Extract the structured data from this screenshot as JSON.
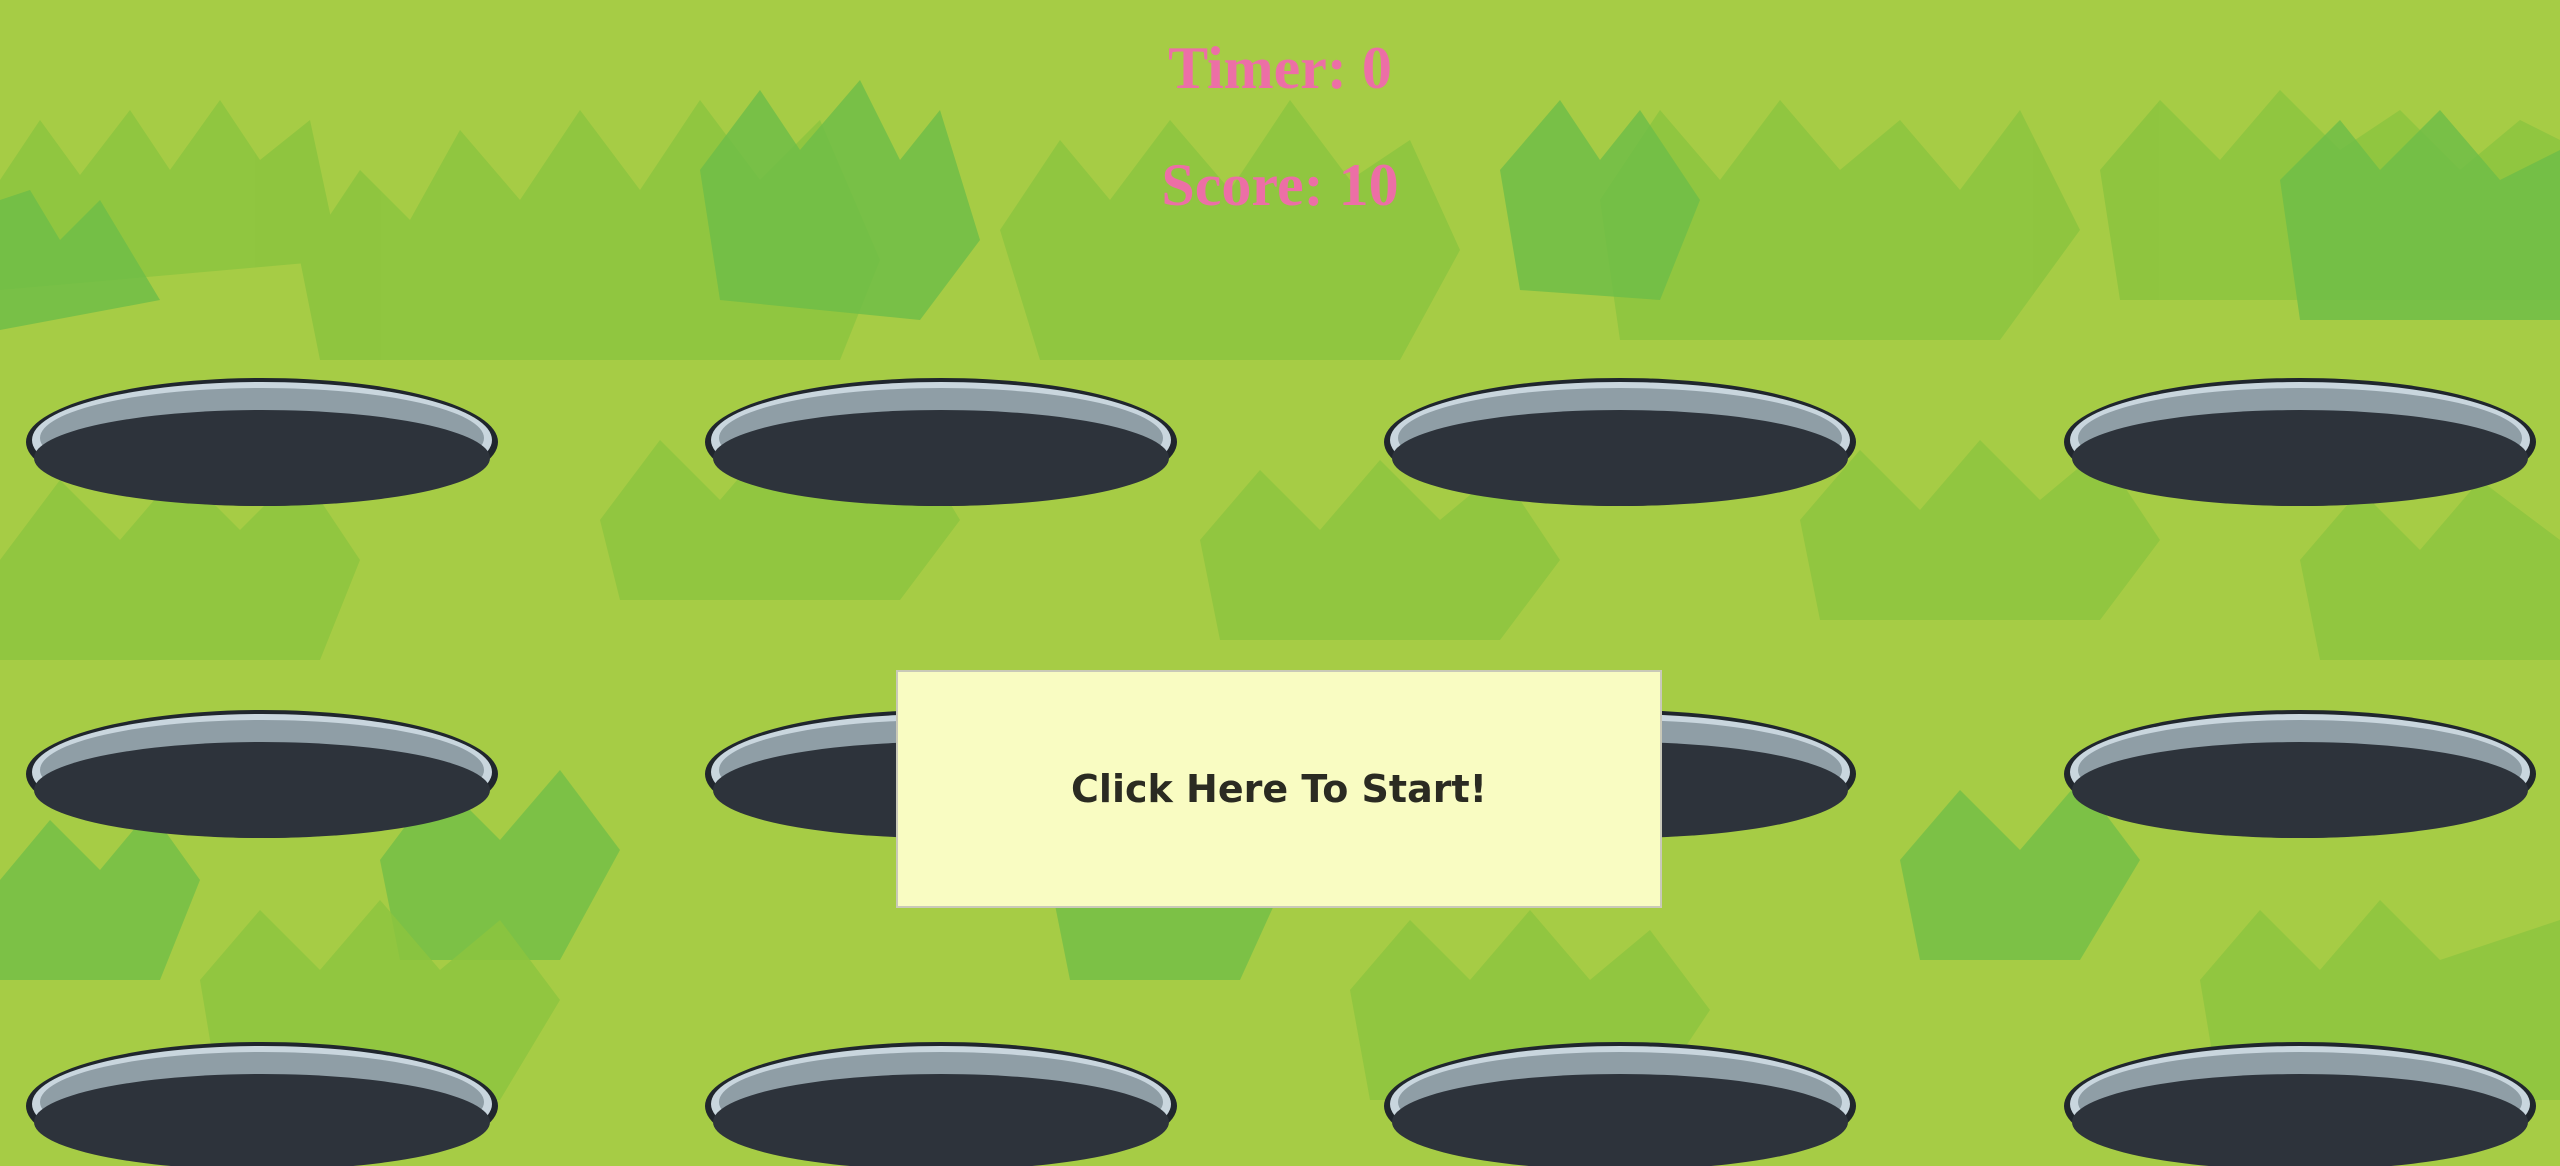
{
  "hud": {
    "timer_label": "Timer:",
    "timer_value": "0",
    "score_label": "Score:",
    "score_value": "10"
  },
  "start_button": {
    "label": "Click Here To Start!"
  },
  "board": {
    "hole_count": 12,
    "rows": 3,
    "columns": 4
  },
  "colors": {
    "grass_light": "#a6cc45",
    "grass_mid": "#8cc43f",
    "grass_dark": "#6dbd47",
    "hud_text": "#ec6fa6",
    "hole_dark": "#2d333b",
    "hole_rim": "#c9d6de",
    "button_bg": "#f9fcc2"
  }
}
